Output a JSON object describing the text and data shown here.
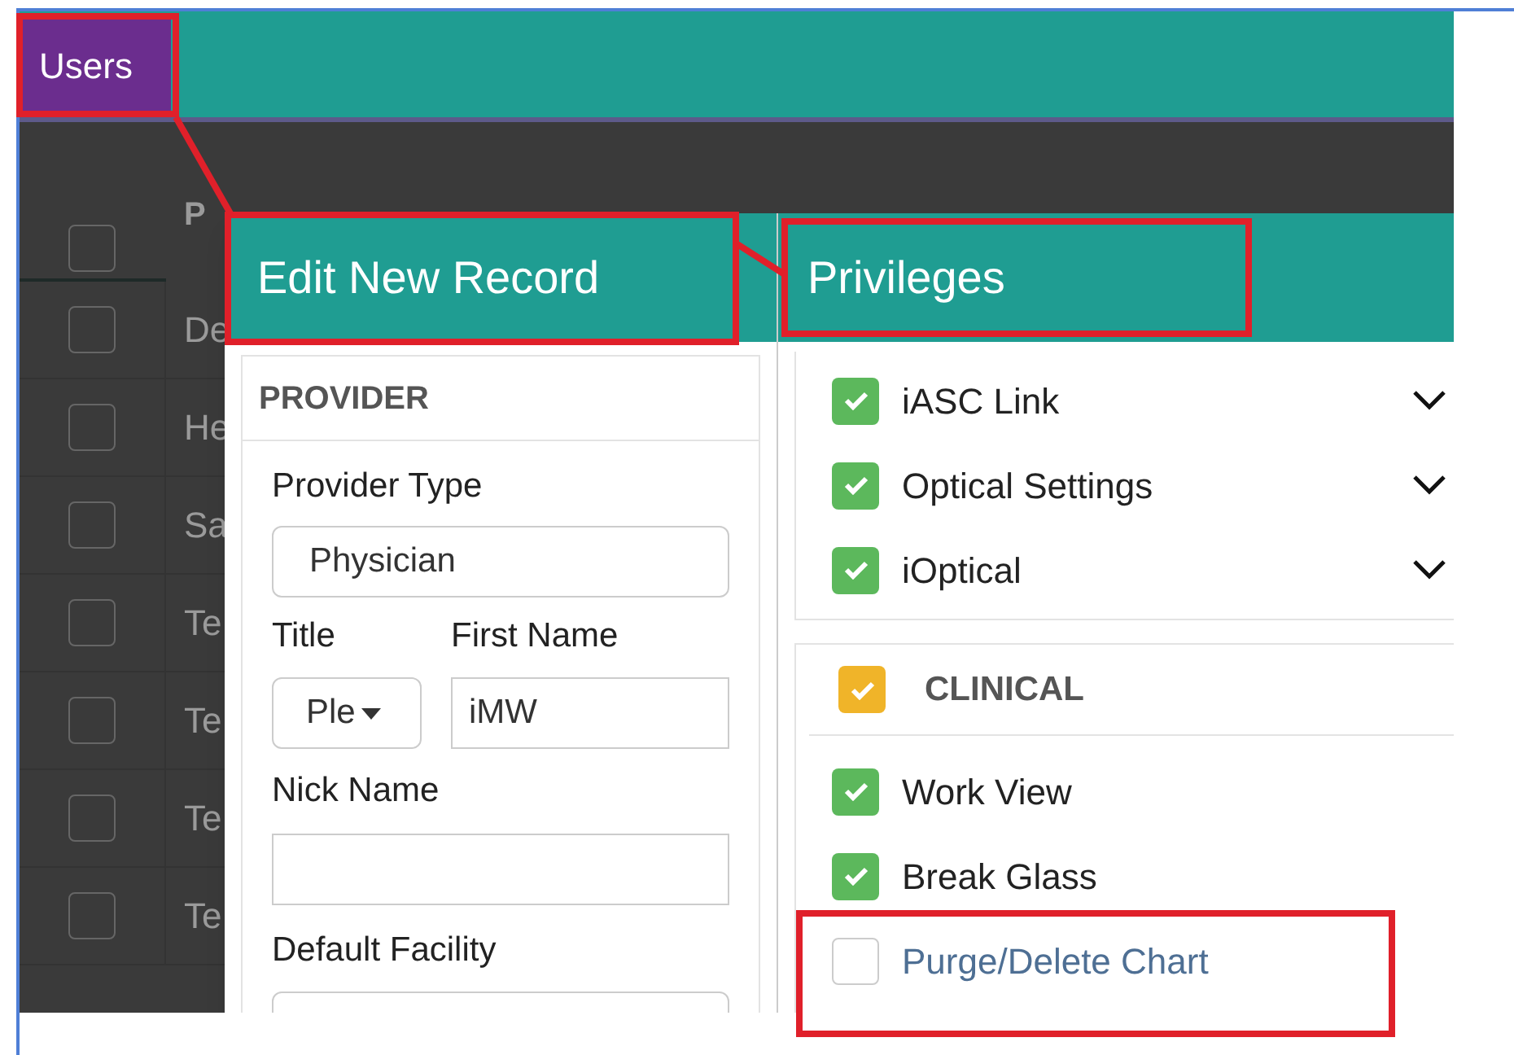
{
  "tab": {
    "label": "Users",
    "selected": true
  },
  "list": {
    "header": "P",
    "all_checked": false,
    "rows": [
      {
        "name": "De",
        "checked": false
      },
      {
        "name": "He",
        "checked": false
      },
      {
        "name": "Sa",
        "checked": false
      },
      {
        "name": "Te",
        "checked": false
      },
      {
        "name": "Te",
        "checked": false
      },
      {
        "name": "Te",
        "checked": false
      },
      {
        "name": "Te",
        "checked": false
      }
    ]
  },
  "edit_panel": {
    "title": "Edit New Record",
    "section": "PROVIDER",
    "provider_type": {
      "label": "Provider Type",
      "value": "Physician"
    },
    "title_field": {
      "label": "Title",
      "value": "Ple"
    },
    "first_name": {
      "label": "First Name",
      "value": "iMW"
    },
    "nick_name": {
      "label": "Nick Name"
    },
    "default_facility": {
      "label": "Default Facility"
    }
  },
  "privileges": {
    "title": "Privileges",
    "items": [
      {
        "label": "iASC Link",
        "checked": true,
        "expanded": false
      },
      {
        "label": "Optical Settings",
        "checked": true,
        "expanded": false
      },
      {
        "label": "iOptical",
        "checked": true,
        "expanded": false
      }
    ],
    "section": {
      "label": "CLINICAL",
      "checked": true,
      "items": [
        {
          "label": "Work View",
          "checked": true
        },
        {
          "label": "Break Glass",
          "checked": true
        },
        {
          "label": "Purge/Delete Chart",
          "checked": false
        }
      ]
    }
  }
}
